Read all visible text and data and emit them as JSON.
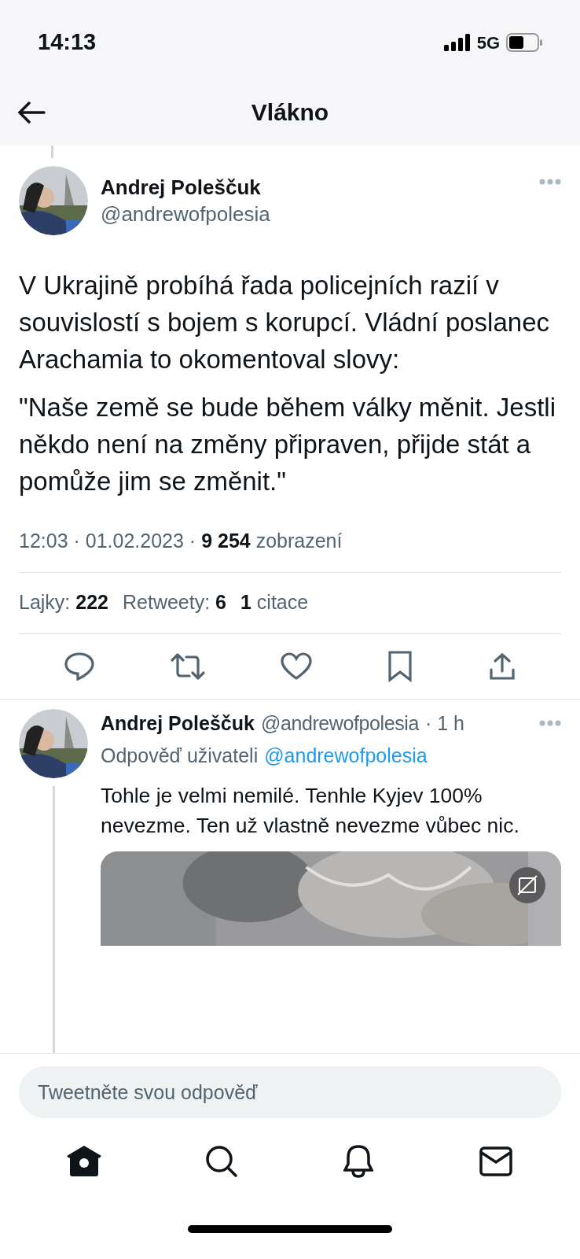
{
  "status_bar": {
    "time": "14:13",
    "network": "5G"
  },
  "header": {
    "title": "Vlákno"
  },
  "tweet": {
    "name": "Andrej Poleščuk",
    "handle": "@andrewofpolesia",
    "paragraphs": [
      "V Ukrajině probíhá řada policejních razií v souvislostí s bojem s korupcí. Vládní poslanec Arachamia to okomentoval slovy:",
      "\"Naše země se bude během války měnit. Jestli někdo není na změny připraven, přijde stát a pomůže jim se změnit.\""
    ],
    "meta": "12:03 · 01.02.2023 · **9 254** zobrazení",
    "stats": [
      "Lajky: **222**",
      "Retweety: **6**",
      "**1** citace"
    ]
  },
  "reply": {
    "name": "Andrej Poleščuk",
    "handle": "@andrewofpolesia",
    "time": "· 1 h",
    "reply_to_label": "Odpověď uživateli",
    "reply_to_link": "@andrewofpolesia",
    "text": "Tohle je velmi nemilé. Tenhle Kyjev 100% nevezme. Ten už vlastně nevezme vůbec nic."
  },
  "composer": {
    "placeholder": "Tweetněte svou odpověď"
  },
  "tab_bar": [
    {
      "kind": "home",
      "selected": true
    },
    {
      "kind": "search",
      "selected": false
    },
    {
      "kind": "bell",
      "selected": false
    },
    {
      "kind": "mail",
      "selected": false
    }
  ]
}
